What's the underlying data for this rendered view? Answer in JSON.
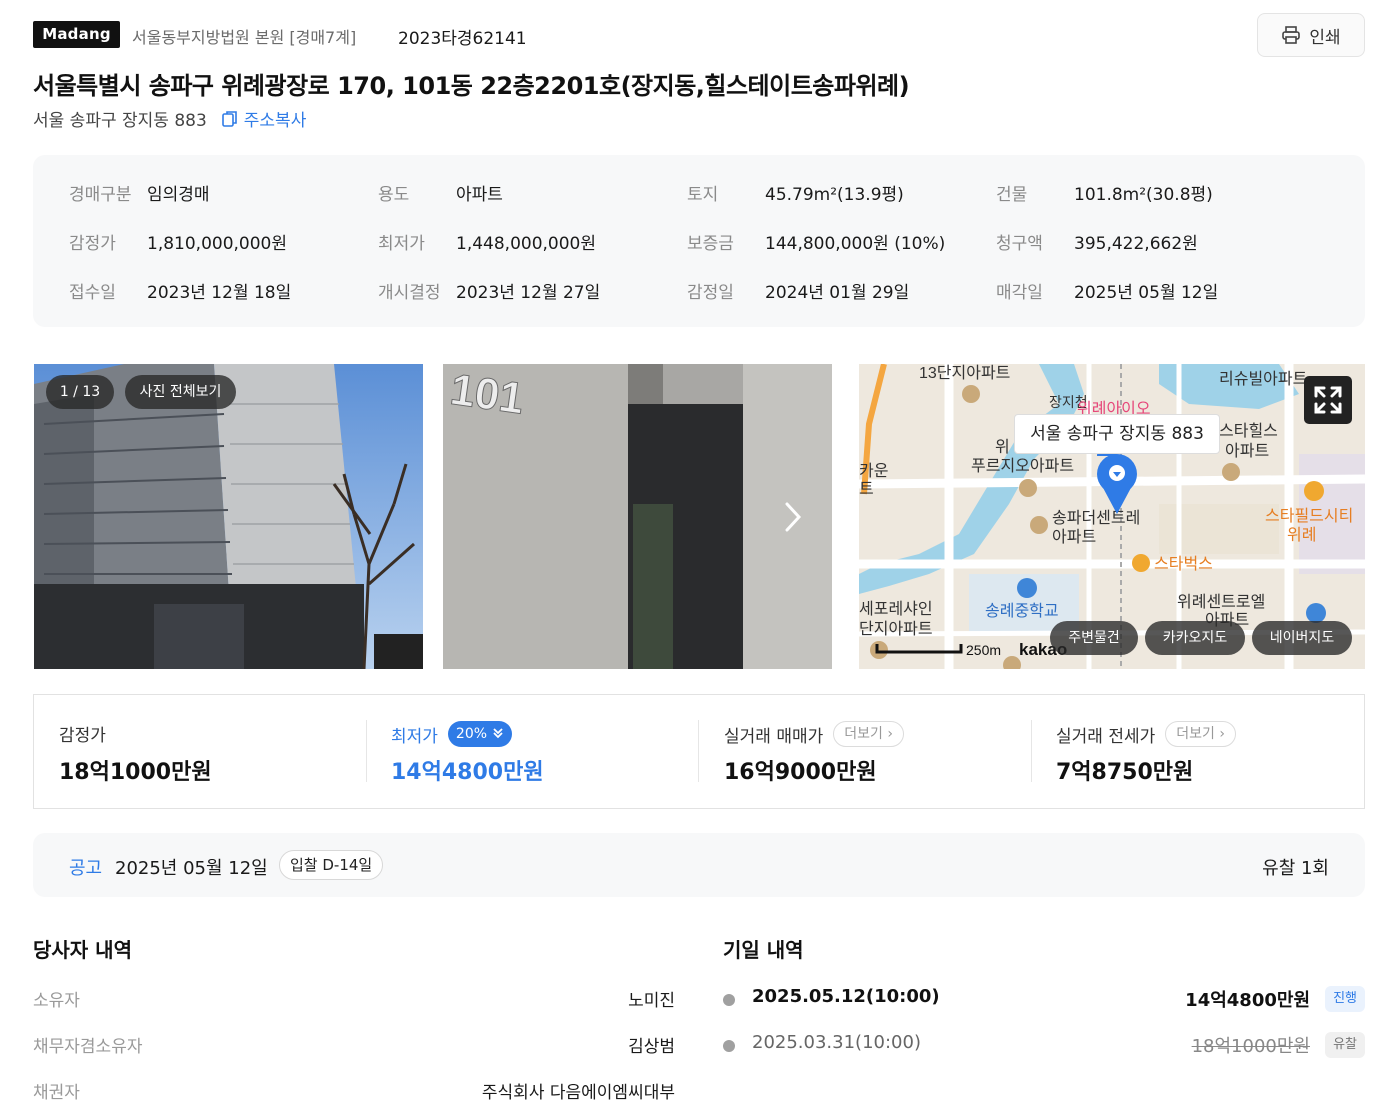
{
  "header": {
    "logo": "Madang",
    "court": "서울동부지방법원 본원 [경매7계]",
    "case_no": "2023타경62141",
    "print_label": "인쇄"
  },
  "title": "서울특별시 송파구 위례광장로 170, 101동 22층2201호(장지동,힐스테이트송파위례)",
  "sub_address": "서울 송파구 장지동 883",
  "copy_label": "주소복사",
  "info": {
    "auction_type_label": "경매구분",
    "auction_type": "임의경매",
    "use_label": "용도",
    "use": "아파트",
    "land_label": "토지",
    "land": "45.79m²(13.9평)",
    "building_label": "건물",
    "building": "101.8m²(30.8평)",
    "appraisal_label": "감정가",
    "appraisal": "1,810,000,000원",
    "min_price_label": "최저가",
    "min_price": "1,448,000,000원",
    "deposit_label": "보증금",
    "deposit": "144,800,000원 (10%)",
    "claim_label": "청구액",
    "claim": "395,422,662원",
    "received_label": "접수일",
    "received": "2023년 12월 18일",
    "start_label": "개시결정",
    "start": "2023년 12월 27일",
    "appraisal_date_label": "감정일",
    "appraisal_date": "2024년 01월 29일",
    "sale_date_label": "매각일",
    "sale_date": "2025년 05월 12일"
  },
  "gallery": {
    "counter": "1 / 13",
    "view_all": "사진 전체보기",
    "photo2_sign": "101"
  },
  "map": {
    "tooltip": "서울 송파구 장지동 883",
    "labels": {
      "l1": "13단지아파트",
      "l2": "리슈빌아파트",
      "l3": "장지천",
      "l4": "위례아이오",
      "l5": "스타힐스",
      "l6": "아파트",
      "l7": "위",
      "l8": "푸르지오아파트",
      "l9": "송파더센트레",
      "l10": "아파트",
      "l11": "스타필드시티",
      "l12": "위례",
      "l13": "스타벅스",
      "l14": "송례중학교",
      "l15": "위례센트로엘",
      "l16": "아파트",
      "l17": "세포레샤인",
      "l18": "단지아파트",
      "l19": "카운",
      "l20": "트"
    },
    "scale": "250m",
    "brand": "kakao",
    "btn_nearby": "주변물건",
    "btn_kakao": "카카오지도",
    "btn_naver": "네이버지도"
  },
  "prices": {
    "appraisal_label": "감정가",
    "appraisal_value": "18억1000만원",
    "min_label": "최저가",
    "min_pct": "20%",
    "min_value": "14억4800만원",
    "trade_label": "실거래 매매가",
    "trade_more": "더보기",
    "trade_value": "16억9000만원",
    "lease_label": "실거래 전세가",
    "lease_more": "더보기",
    "lease_value": "7억8750만원"
  },
  "notice": {
    "label": "공고",
    "date": "2025년 05월 12일",
    "dday": "입찰 D-14일",
    "fail_count": "유찰 1회"
  },
  "parties": {
    "title": "당사자 내역",
    "rows": [
      {
        "label": "소유자",
        "value": "노미진"
      },
      {
        "label": "채무자겸소유자",
        "value": "김상범"
      },
      {
        "label": "채권자",
        "value": "주식회사 다음에이엠씨대부"
      }
    ]
  },
  "dates": {
    "title": "기일 내역",
    "rows": [
      {
        "date": "2025.05.12(10:00)",
        "price": "14억4800만원",
        "status": "진행"
      },
      {
        "date": "2025.03.31(10:00)",
        "price": "18억1000만원",
        "status": "유찰"
      }
    ]
  },
  "colors": {
    "accent": "#2f7be6",
    "map_pin": "#2f7be6",
    "badge_text": "#ffffff"
  }
}
